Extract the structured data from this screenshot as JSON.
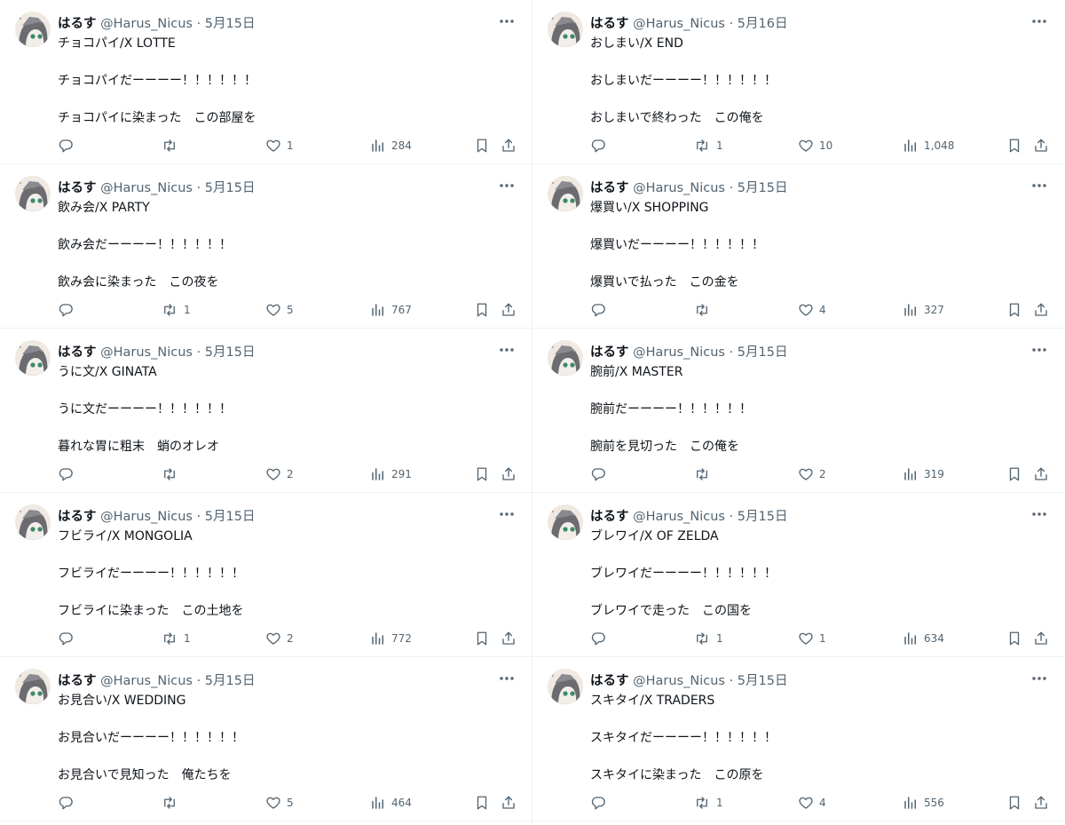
{
  "author": {
    "name": "はるす",
    "handle": "@Harus_Nicus",
    "separator": "·"
  },
  "columns": [
    [
      {
        "date": "5月15日",
        "lines": [
          "チョコパイ/X LOTTE",
          "チョコパイだーーーー！！！！！！",
          "チョコパイに染まった　この部屋を"
        ],
        "reply": "",
        "retweet": "",
        "like": "1",
        "views": "284"
      },
      {
        "date": "5月15日",
        "lines": [
          "飲み会/X PARTY",
          "飲み会だーーーー！！！！！！",
          "飲み会に染まった　この夜を"
        ],
        "reply": "",
        "retweet": "1",
        "like": "5",
        "views": "767"
      },
      {
        "date": "5月15日",
        "lines": [
          "うに文/X GINATA",
          "うに文だーーーー！！！！！！",
          "暮れな胃に粗末　蛸のオレオ"
        ],
        "reply": "",
        "retweet": "",
        "like": "2",
        "views": "291"
      },
      {
        "date": "5月15日",
        "lines": [
          "フビライ/X MONGOLIA",
          "フビライだーーーー！！！！！！",
          "フビライに染まった　この土地を"
        ],
        "reply": "",
        "retweet": "1",
        "like": "2",
        "views": "772"
      },
      {
        "date": "5月15日",
        "lines": [
          "お見合い/X WEDDING",
          "お見合いだーーーー！！！！！！",
          "お見合いで見知った　俺たちを"
        ],
        "reply": "",
        "retweet": "",
        "like": "5",
        "views": "464"
      }
    ],
    [
      {
        "date": "5月16日",
        "lines": [
          "おしまい/X END",
          "おしまいだーーーー！！！！！！",
          "おしまいで終わった　この俺を"
        ],
        "reply": "",
        "retweet": "1",
        "like": "10",
        "views": "1,048"
      },
      {
        "date": "5月15日",
        "lines": [
          "爆買い/X SHOPPING",
          "爆買いだーーーー！！！！！！",
          "爆買いで払った　この金を"
        ],
        "reply": "",
        "retweet": "",
        "like": "4",
        "views": "327"
      },
      {
        "date": "5月15日",
        "lines": [
          "腕前/X MASTER",
          "腕前だーーーー！！！！！！",
          "腕前を見切った　この俺を"
        ],
        "reply": "",
        "retweet": "",
        "like": "2",
        "views": "319"
      },
      {
        "date": "5月15日",
        "lines": [
          "ブレワイ/X OF ZELDA",
          "ブレワイだーーーー！！！！！！",
          "ブレワイで走った　この国を"
        ],
        "reply": "",
        "retweet": "1",
        "like": "1",
        "views": "634"
      },
      {
        "date": "5月15日",
        "lines": [
          "スキタイ/X TRADERS",
          "スキタイだーーーー！！！！！！",
          "スキタイに染まった　この原を"
        ],
        "reply": "",
        "retweet": "1",
        "like": "4",
        "views": "556"
      }
    ]
  ],
  "icons": {
    "avatar": "avatar",
    "more": "more-icon",
    "reply": "reply-icon",
    "retweet": "retweet-icon",
    "like": "heart-icon",
    "views": "views-icon",
    "bookmark": "bookmark-icon",
    "share": "share-icon"
  },
  "colors": {
    "text": "#0f1419",
    "secondary": "#536471",
    "border": "#eff3f4"
  }
}
